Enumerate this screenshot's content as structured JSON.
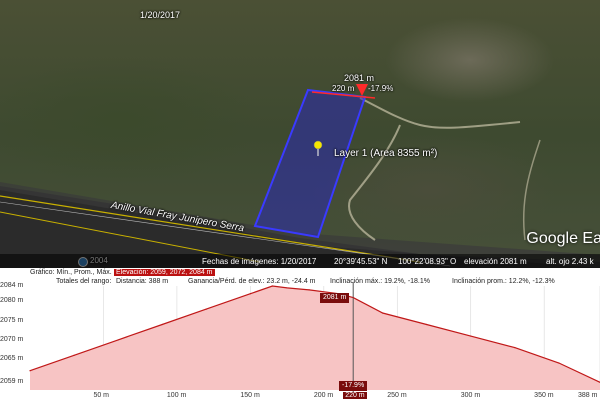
{
  "map": {
    "top_date": "1/20/2017",
    "marker_elevation": "2081 m",
    "marker_distance": "220 m",
    "marker_slope": "-17.9%",
    "layer_label": "Layer 1 (Area 8355 m²)",
    "road_label": "Anillo Vial Fray Junipero Serra",
    "year_label": "2004",
    "watermark": "Google Ea",
    "colors": {
      "polygon_fill": "#2a2ab0",
      "polygon_stroke": "#3a3aff",
      "marker": "#ff2a2a",
      "pushpin": "#f5e600"
    }
  },
  "status": {
    "imagery_date": "Fechas de imágenes: 1/20/2017",
    "latitude": "20°39'45.53\" N",
    "longitude": "100°22'08.93\" O",
    "elevation": "elevación  2081 m",
    "eye_alt": "alt. ojo  2.43 k"
  },
  "profile": {
    "graph_label": "Gráfico: Mín., Prom., Máx.",
    "elevation_values": "Elevación: 2059, 2072, 2084 m",
    "totals_label": "Totales del rango:",
    "distance": "Distancia: 388 m",
    "gain_loss": "Ganancia/Pérd. de elev.: 23.2 m, -24.4 m",
    "max_slope": "Inclinación máx.: 19.2%, -18.1%",
    "avg_slope": "Inclinación prom.: 12.2%, -12.3%",
    "y_ticks": [
      "2084 m",
      "2080 m",
      "2075 m",
      "2070 m",
      "2065 m",
      "2059 m"
    ],
    "x_ticks": [
      "50 m",
      "100 m",
      "150 m",
      "200 m",
      "220 m",
      "250 m",
      "300 m",
      "350 m",
      "388 m"
    ],
    "cursor_elevation": "2081 m",
    "cursor_slope": "-17.9%",
    "colors": {
      "fill": "#f7c4c4",
      "line": "#c01818",
      "cursor": "#555555"
    }
  },
  "chart_data": {
    "type": "area",
    "xlabel": "",
    "ylabel": "",
    "x": [
      0,
      30,
      60,
      90,
      120,
      150,
      165,
      175,
      190,
      210,
      220,
      240,
      270,
      300,
      330,
      360,
      388
    ],
    "y": [
      2062,
      2066,
      2070,
      2074,
      2078,
      2082,
      2084,
      2083.5,
      2083,
      2082,
      2081,
      2077,
      2074,
      2071,
      2068,
      2064,
      2059
    ],
    "xlim": [
      0,
      388
    ],
    "ylim": [
      2057,
      2084
    ]
  }
}
